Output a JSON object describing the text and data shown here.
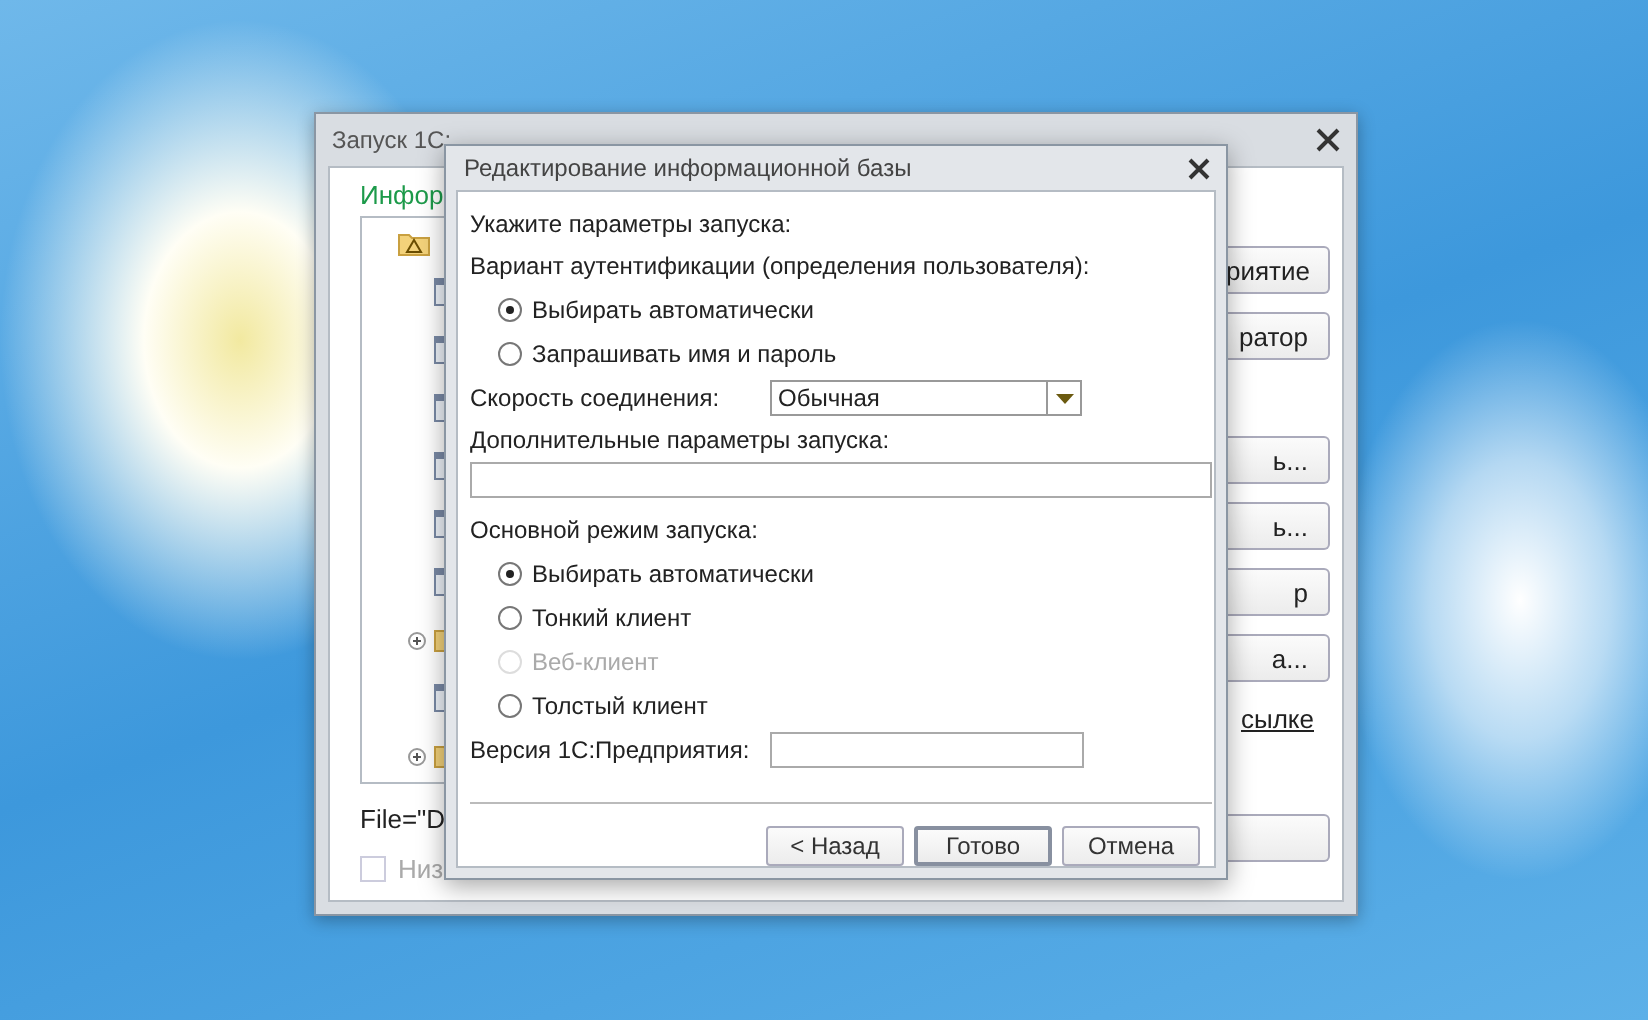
{
  "back_window": {
    "title": "Запуск 1С:",
    "section_label": "Инфор",
    "tree": [
      {
        "kind": "group",
        "children": [
          {
            "kind": "document"
          },
          {
            "kind": "document"
          },
          {
            "kind": "document"
          },
          {
            "kind": "document"
          },
          {
            "kind": "document"
          },
          {
            "kind": "document"
          },
          {
            "kind": "folder",
            "expanded": false
          },
          {
            "kind": "document"
          },
          {
            "kind": "folder",
            "expanded": false
          }
        ]
      }
    ],
    "buttons": [
      {
        "label": "риятие"
      },
      {
        "label": "ратор"
      },
      {
        "label": "ь..."
      },
      {
        "label": "ь..."
      },
      {
        "label": "р"
      },
      {
        "label": "а..."
      }
    ],
    "link": "сылке",
    "path": "File=\"D",
    "checkbox": {
      "label": "Низ",
      "checked": false,
      "disabled": true
    }
  },
  "dialog": {
    "title": "Редактирование информационной базы",
    "prompt": "Укажите параметры запуска:",
    "auth_label": "Вариант аутентификации (определения пользователя):",
    "auth_options": [
      {
        "label": "Выбирать автоматически",
        "selected": true
      },
      {
        "label": "Запрашивать имя и пароль",
        "selected": false
      }
    ],
    "speed": {
      "label": "Скорость соединения:",
      "value": "Обычная"
    },
    "extra_params": {
      "label": "Дополнительные параметры запуска:"
    },
    "mode_label": "Основной режим запуска:",
    "mode_options": [
      {
        "label": "Выбирать автоматически",
        "selected": true,
        "disabled": false
      },
      {
        "label": "Тонкий клиент",
        "selected": false,
        "disabled": false
      },
      {
        "label": "Веб-клиент",
        "selected": false,
        "disabled": true
      },
      {
        "label": "Толстый клиент",
        "selected": false,
        "disabled": false
      }
    ],
    "version": {
      "label": "Версия 1С:Предприятия:"
    },
    "buttons": [
      {
        "label": "< Назад",
        "default": false
      },
      {
        "label": "Готово",
        "default": true
      },
      {
        "label": "Отмена",
        "default": false
      }
    ]
  }
}
